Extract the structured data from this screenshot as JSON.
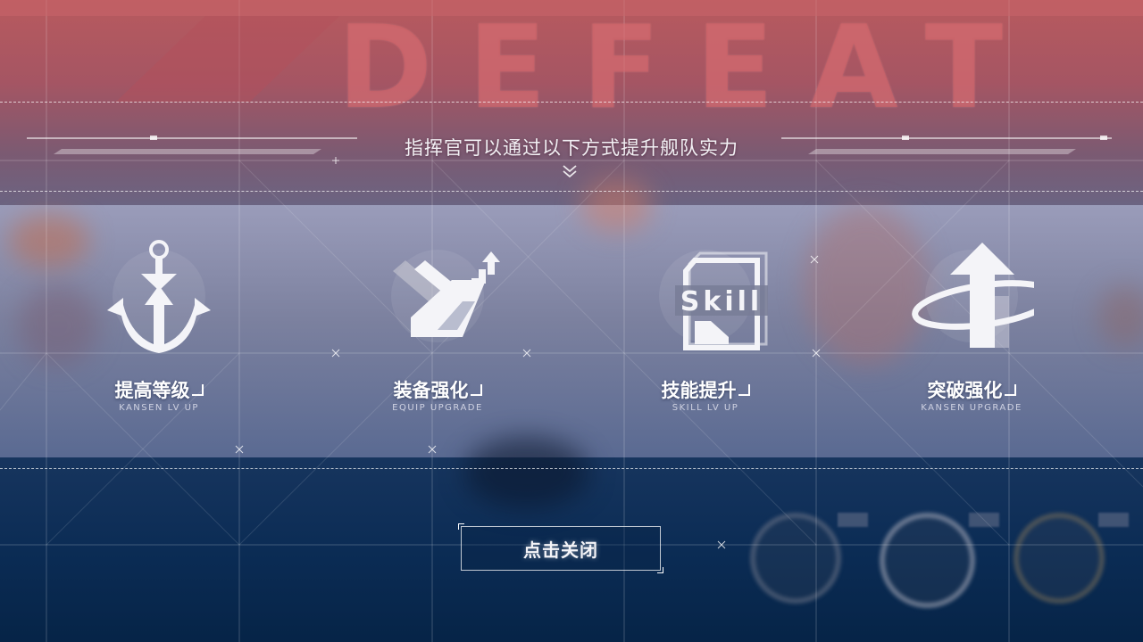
{
  "banner": {
    "result_text": "DEFEAT",
    "subtitle": "指挥官可以通过以下方式提升舰队实力"
  },
  "options": [
    {
      "id": "level",
      "title": "提高等级",
      "subtitle": "KANSEN LV UP",
      "icon": "anchor-icon"
    },
    {
      "id": "equip",
      "title": "装备强化",
      "subtitle": "EQUIP UPGRADE",
      "icon": "equipment-upgrade-icon"
    },
    {
      "id": "skill",
      "title": "技能提升",
      "subtitle": "SKILL LV UP",
      "icon": "skill-card-icon",
      "icon_text": "Skill"
    },
    {
      "id": "limit",
      "title": "突破强化",
      "subtitle": "KANSEN UPGRADE",
      "icon": "limit-break-arrow-icon"
    }
  ],
  "close_button": {
    "label": "点击关闭"
  },
  "colors": {
    "defeat_red": "#b85a5e",
    "panel_blue": "#0b2c55",
    "text_white": "#ffffff"
  }
}
